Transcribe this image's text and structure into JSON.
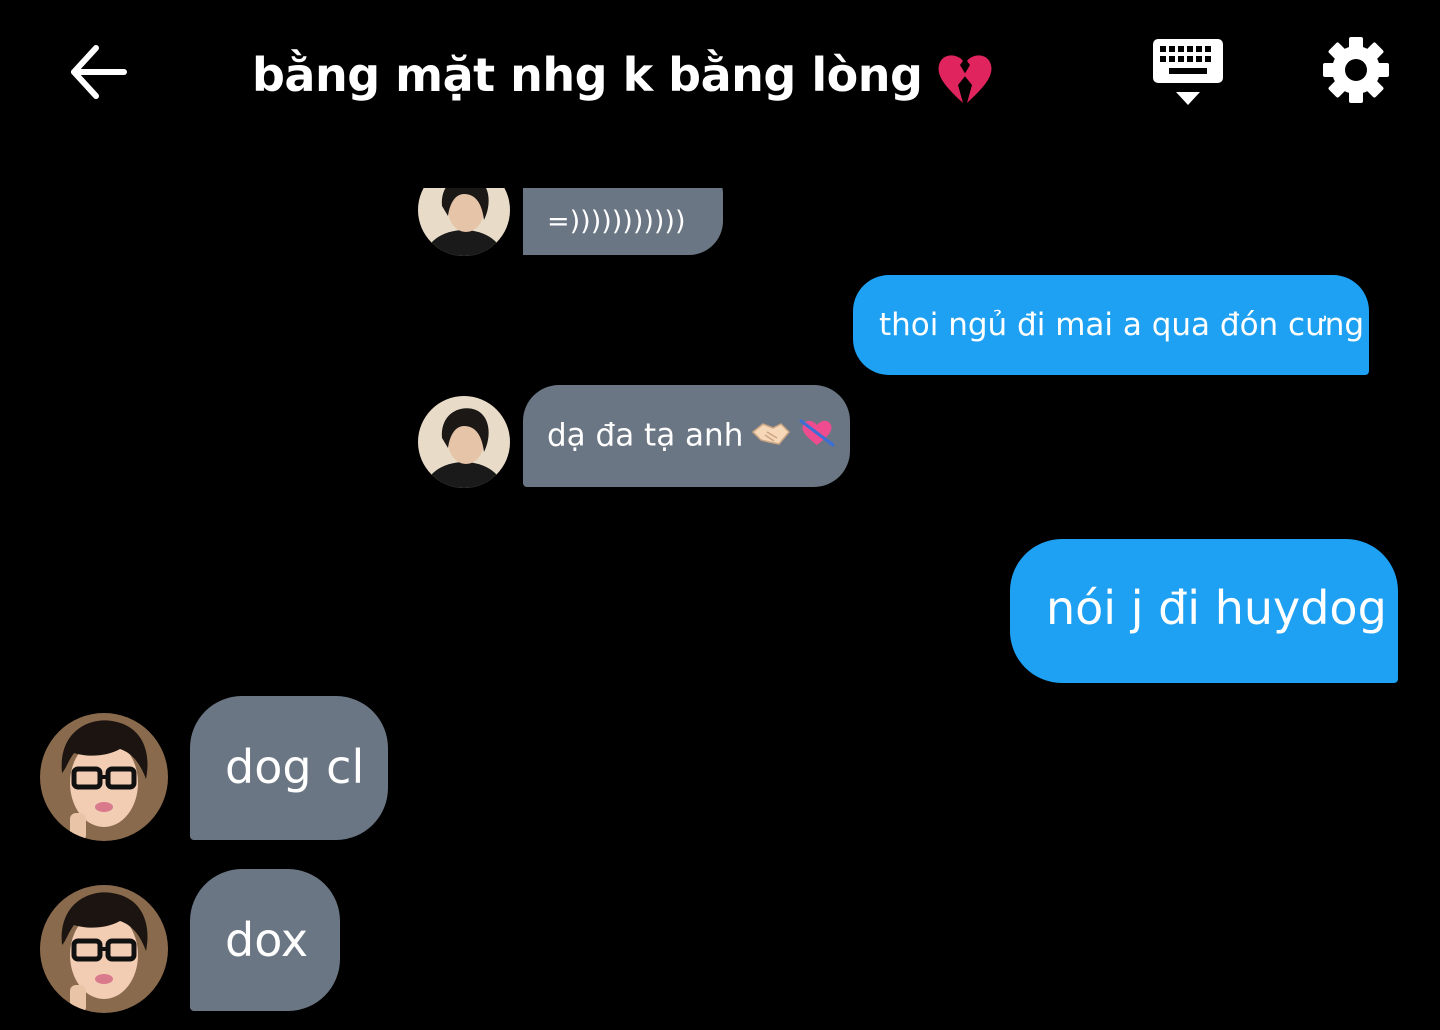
{
  "header": {
    "back_icon": "arrow-left-icon",
    "title": "bằng mặt nhg k bằng lòng",
    "title_emoji": "broken-heart-emoji",
    "keyboard_icon": "keyboard-icon",
    "settings_icon": "gear-icon"
  },
  "colors": {
    "background": "#000000",
    "incoming_bubble": "#6b7684",
    "outgoing_bubble": "#1ea1f2",
    "text": "#ffffff"
  },
  "messages": [
    {
      "direction": "incoming",
      "text": "=)))))))))))",
      "avatar": "avatar-contact-1"
    },
    {
      "direction": "outgoing",
      "text": "thoi ngủ đi mai a qua đón cưng"
    },
    {
      "direction": "incoming",
      "text": "dạ đa tạ anh",
      "emojis": [
        "handshake-emoji",
        "heart-with-arrow-emoji"
      ],
      "avatar": "avatar-contact-1"
    },
    {
      "direction": "outgoing",
      "text": "nói j đi huydog"
    },
    {
      "direction": "incoming",
      "text": "dog cl",
      "avatar": "avatar-contact-2"
    },
    {
      "direction": "incoming",
      "text": "dox",
      "avatar": "avatar-contact-2"
    }
  ]
}
